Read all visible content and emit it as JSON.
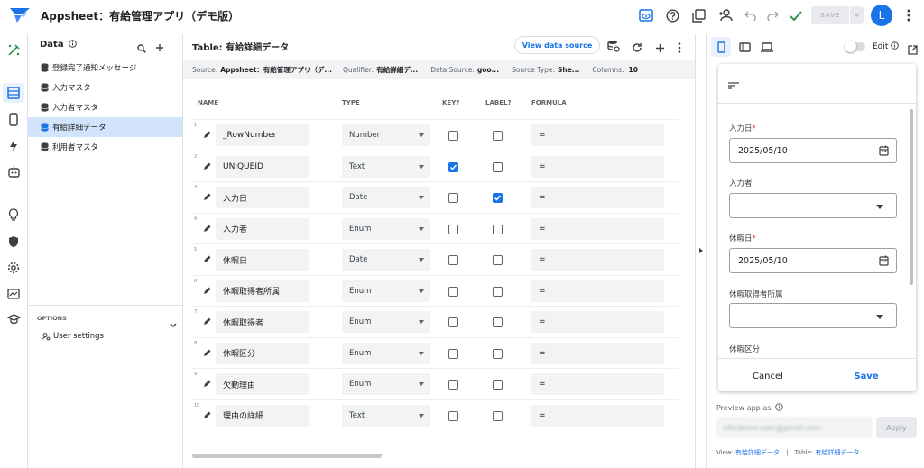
{
  "app": {
    "title": "Appsheet：有給管理アプリ（デモ版）",
    "save_label": "SAVE",
    "avatar_initial": "L"
  },
  "data_panel": {
    "heading": "Data",
    "tables": [
      {
        "label": "登録完了通知メッセージ"
      },
      {
        "label": "入力マスタ"
      },
      {
        "label": "入力者マスタ"
      },
      {
        "label": "有給詳細データ"
      },
      {
        "label": "利用者マスタ"
      }
    ],
    "options_heading": "OPTIONS",
    "user_settings": "User settings"
  },
  "table_view": {
    "title": "Table: 有給詳細データ",
    "view_data_source": "View data source",
    "info": {
      "source_label": "Source:",
      "source_value": "Appsheet：有給管理アプリ（デ...",
      "qualifier_label": "Qualifier:",
      "qualifier_value": "有給詳細デ...",
      "datasource_label": "Data Source:",
      "datasource_value": "goo...",
      "sourcetype_label": "Source Type:",
      "sourcetype_value": "She...",
      "columns_label": "Columns:",
      "columns_value": "10"
    },
    "headers": {
      "name": "NAME",
      "type": "TYPE",
      "key": "KEY?",
      "label": "LABEL?",
      "formula": "FORMULA"
    },
    "rows": [
      {
        "num": "1",
        "name": "_RowNumber",
        "type": "Number",
        "key": false,
        "label": false,
        "formula": "="
      },
      {
        "num": "2",
        "name": "UNIQUEID",
        "type": "Text",
        "key": true,
        "label": false,
        "formula": "="
      },
      {
        "num": "3",
        "name": "入力日",
        "type": "Date",
        "key": false,
        "label": true,
        "formula": "="
      },
      {
        "num": "4",
        "name": "入力者",
        "type": "Enum",
        "key": false,
        "label": false,
        "formula": "="
      },
      {
        "num": "5",
        "name": "休暇日",
        "type": "Date",
        "key": false,
        "label": false,
        "formula": "="
      },
      {
        "num": "6",
        "name": "休暇取得者所属",
        "type": "Enum",
        "key": false,
        "label": false,
        "formula": "="
      },
      {
        "num": "7",
        "name": "休暇取得者",
        "type": "Enum",
        "key": false,
        "label": false,
        "formula": "="
      },
      {
        "num": "8",
        "name": "休暇区分",
        "type": "Enum",
        "key": false,
        "label": false,
        "formula": "="
      },
      {
        "num": "9",
        "name": "欠勤理由",
        "type": "Enum",
        "key": false,
        "label": false,
        "formula": "="
      },
      {
        "num": "10",
        "name": "理由の詳細",
        "type": "Text",
        "key": false,
        "label": false,
        "formula": "="
      }
    ]
  },
  "preview_panel": {
    "edit_label": "Edit",
    "form": {
      "fields": [
        {
          "label": "入力日",
          "required": true,
          "value": "2025/05/10",
          "kind": "date"
        },
        {
          "label": "入力者",
          "required": false,
          "value": "",
          "kind": "enum"
        },
        {
          "label": "休暇日",
          "required": true,
          "value": "2025/05/10",
          "kind": "date"
        },
        {
          "label": "休暇取得者所属",
          "required": false,
          "value": "",
          "kind": "enum"
        },
        {
          "label": "休暇区分",
          "required": false,
          "value": "",
          "kind": "enum"
        }
      ],
      "cancel": "Cancel",
      "save": "Save"
    },
    "preview_as_label": "Preview app as",
    "preview_as_value": "k8xdemo-user@gmail.com",
    "apply": "Apply",
    "footer": {
      "view_label": "View:",
      "view_value": "有給詳細データ",
      "sep": "|",
      "table_label": "Table:",
      "table_value": "有給詳細データ"
    }
  },
  "colors": {
    "accent": "#1a73e8",
    "selected_bg": "#d2e3fc",
    "field_bg": "#f1f3f4"
  }
}
